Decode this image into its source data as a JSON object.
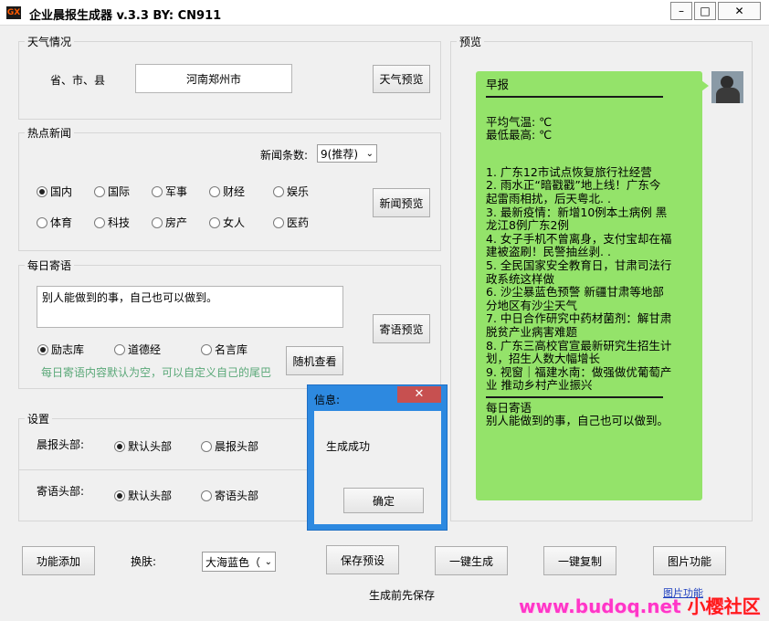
{
  "window": {
    "title": "企业晨报生成器  v.3.3 BY:  CN911",
    "icon_text": "GX",
    "controls": {
      "minimize": "–",
      "maximize": "□",
      "close": "✕"
    }
  },
  "weather": {
    "legend": "天气情况",
    "location_label": "省、市、县",
    "location_value": "河南郑州市",
    "preview_button": "天气预览"
  },
  "news": {
    "legend": "热点新闻",
    "count_label": "新闻条数:",
    "count_value": "9(推荐)",
    "categories": [
      {
        "label": "国内",
        "selected": true
      },
      {
        "label": "国际",
        "selected": false
      },
      {
        "label": "军事",
        "selected": false
      },
      {
        "label": "财经",
        "selected": false
      },
      {
        "label": "娱乐",
        "selected": false
      },
      {
        "label": "体育",
        "selected": false
      },
      {
        "label": "科技",
        "selected": false
      },
      {
        "label": "房产",
        "selected": false
      },
      {
        "label": "女人",
        "selected": false
      },
      {
        "label": "医药",
        "selected": false
      }
    ],
    "preview_button": "新闻预览"
  },
  "quote": {
    "legend": "每日寄语",
    "text_value": "别人能做到的事，自己也可以做到。",
    "sources": [
      {
        "label": "励志库",
        "selected": true
      },
      {
        "label": "道德经",
        "selected": false
      },
      {
        "label": "名言库",
        "selected": false
      }
    ],
    "hint": "每日寄语内容默认为空，可以自定义自己的尾巴",
    "preview_button": "寄语预览",
    "random_button": "随机查看"
  },
  "settings": {
    "legend": "设置",
    "morning_header_label": "晨报头部:",
    "morning_options": [
      {
        "label": "默认头部",
        "selected": true
      },
      {
        "label": "晨报头部",
        "selected": false
      }
    ],
    "quote_header_label": "寄语头部:",
    "quote_options": [
      {
        "label": "默认头部",
        "selected": true
      },
      {
        "label": "寄语头部",
        "selected": false
      }
    ]
  },
  "preview": {
    "legend": "预览",
    "title": "早报",
    "avg_temp": "平均气温: ℃",
    "min_max": "最低最高: ℃",
    "news_lines": [
      "1. 广东12市试点恢复旅行社经营",
      "2. 雨水正“暗戳戳”地上线！广东今",
      "起雷雨相扰，后天粤北. .",
      "3. 最新疫情：新增10例本土病例  黑",
      "龙江8例广东2例",
      "4. 女子手机不曾离身，支付宝却在福",
      "建被盗刷！民警抽丝剥. .",
      "5. 全民国家安全教育日，甘肃司法行",
      "政系统这样做",
      "6. 沙尘暴蓝色预警  新疆甘肃等地部",
      "分地区有沙尘天气",
      "7. 中日合作研究中药材菌剂：解甘肃",
      "脱贫产业病害难题",
      "8. 广东三高校官宣最新研究生招生计",
      "划，招生人数大幅增长",
      "9. 视窗｜福建水南：做强做优葡萄产",
      "业  推动乡村产业振兴"
    ],
    "quote_heading": "每日寄语",
    "quote_text": "别人能做到的事，自己也可以做到。"
  },
  "dialog": {
    "title": "信息:",
    "close": "✕",
    "message": "生成成功",
    "ok_button": "确定"
  },
  "toolbar": {
    "add_feature": "功能添加",
    "skin_label": "换肤:",
    "skin_value": "大海蓝色（",
    "save_preset": "保存预设",
    "generate": "一键生成",
    "copy": "一键复制",
    "image": "图片功能",
    "status": "生成前先保存",
    "image_link": "图片功能"
  },
  "watermark": {
    "prefix": "www.budoq.net",
    "suffix": "小樱社区"
  }
}
